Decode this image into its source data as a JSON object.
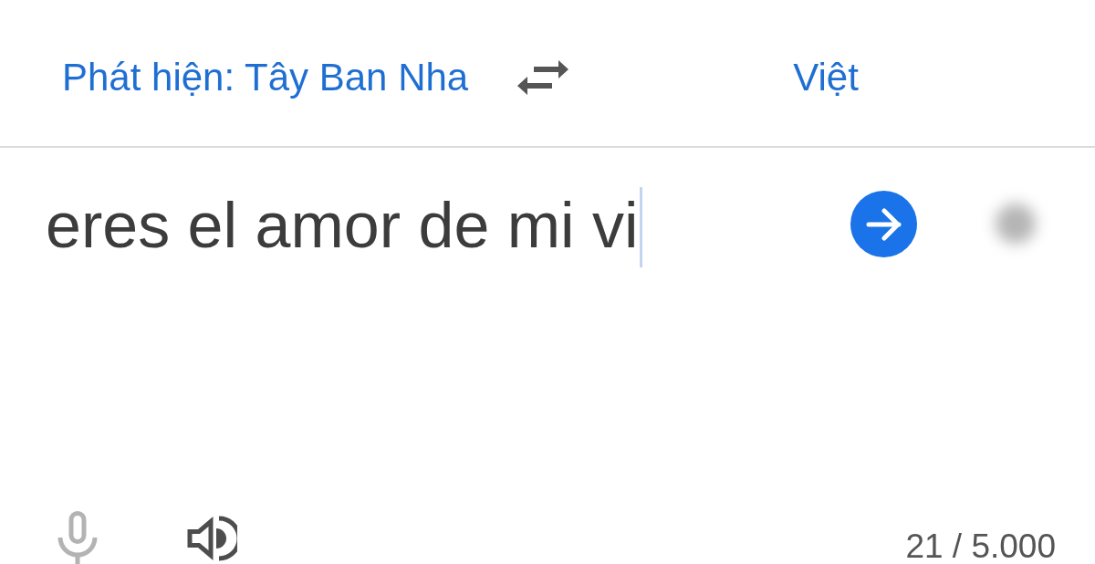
{
  "language_bar": {
    "source_language": {
      "label": "Phát hiện: Tây Ban Nha"
    },
    "target_language": {
      "label": "Việt"
    }
  },
  "input": {
    "value": "eres el amor de mi vi"
  },
  "bottom_bar": {
    "controls": [
      {
        "kind": "microphone",
        "disabled": true
      },
      {
        "kind": "speaker",
        "disabled": false
      }
    ],
    "character_count": "21 / 5.000"
  }
}
